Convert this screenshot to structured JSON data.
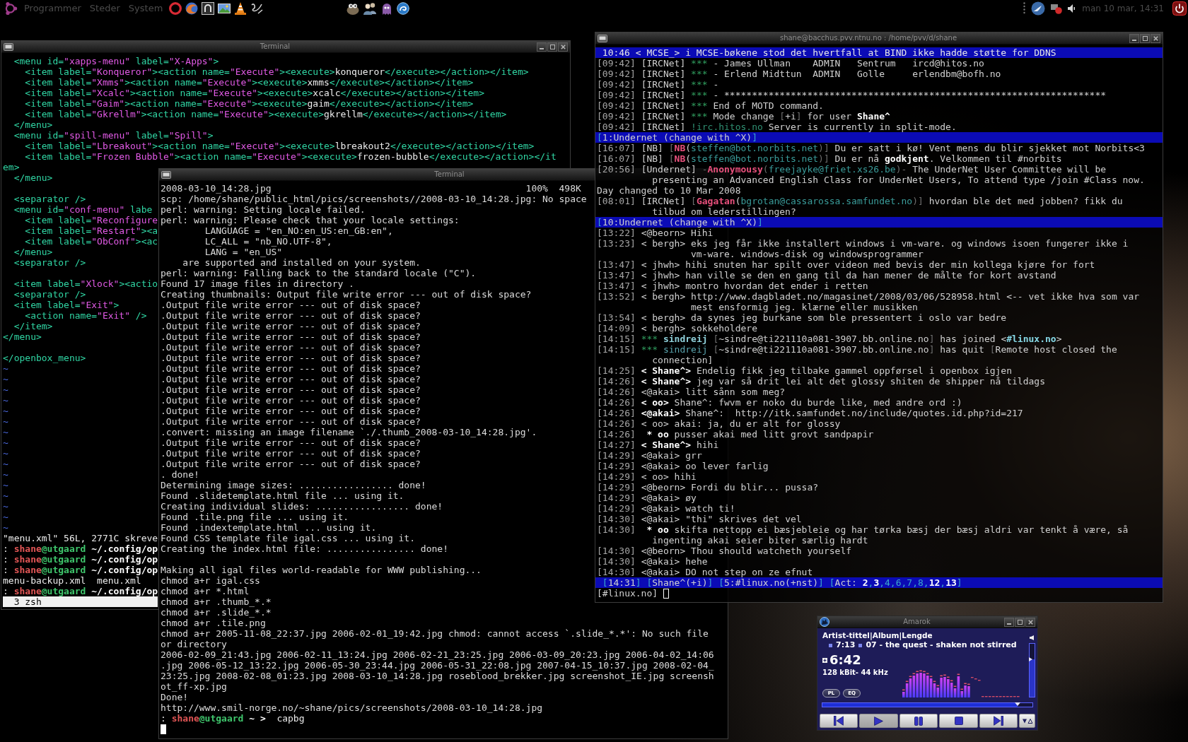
{
  "panel": {
    "menus": [
      "Programmer",
      "Steder",
      "System"
    ],
    "clock": "man 10 mar, 14:31"
  },
  "editor_terminal": {
    "title": "Terminal",
    "lines": [
      {
        "kind": "xml",
        "text": "  <menu id=\"xapps-menu\" label=\"X-Apps\">"
      },
      {
        "kind": "xml",
        "text": "    <item label=\"Konqueror\"><action name=\"Execute\"><execute>konqueror</execute></action></item>"
      },
      {
        "kind": "xml",
        "text": "    <item label=\"Xmms\"><action name=\"Execute\"><execute>xmms</execute></action></item>"
      },
      {
        "kind": "xml",
        "text": "    <item label=\"Xcalc\"><action name=\"Execute\"><execute>xcalc</execute></action></item>"
      },
      {
        "kind": "xml",
        "text": "    <item label=\"Gaim\"><action name=\"Execute\"><execute>gaim</execute></action></item>"
      },
      {
        "kind": "xml",
        "text": "    <item label=\"Gkrellm\"><action name=\"Execute\"><execute>gkrellm</execute></action></item>"
      },
      {
        "kind": "xml",
        "text": "  </menu>"
      },
      {
        "kind": "xml",
        "text": "  <menu id=\"spill-menu\" label=\"Spill\">"
      },
      {
        "kind": "xml",
        "text": "    <item label=\"Lbreakout\"><action name=\"Execute\"><execute>lbreakout2</execute></action></item>"
      },
      {
        "kind": "xml",
        "text": "    <item label=\"Frozen Bubble\"><action name=\"Execute\"><execute>frozen-bubble</execute></action></it"
      },
      {
        "kind": "xml",
        "text": "em>"
      },
      {
        "kind": "xml",
        "text": "  </menu>"
      },
      {
        "kind": "blank"
      },
      {
        "kind": "xml",
        "text": "  <separator />"
      },
      {
        "kind": "xml",
        "text": "  <menu id=\"conf-menu\" labe"
      },
      {
        "kind": "xml",
        "text": "    <item label=\"Reconfigure"
      },
      {
        "kind": "xml",
        "text": "    <item label=\"Restart\"><a"
      },
      {
        "kind": "xml",
        "text": "    <item label=\"ObConf\"><ac"
      },
      {
        "kind": "xml",
        "text": "  </menu>"
      },
      {
        "kind": "xml",
        "text": "  <separator />"
      },
      {
        "kind": "blank"
      },
      {
        "kind": "xml",
        "text": "  <item label=\"Xlock\"><actio"
      },
      {
        "kind": "xml",
        "text": "  <separator />"
      },
      {
        "kind": "xml",
        "text": "  <item label=\"Exit\">"
      },
      {
        "kind": "xml",
        "text": "    <action name=\"Exit\" />"
      },
      {
        "kind": "xml",
        "text": "  </item>"
      },
      {
        "kind": "xml",
        "text": "</menu>"
      },
      {
        "kind": "blank"
      },
      {
        "kind": "xml",
        "text": "</openbox_menu>"
      },
      {
        "kind": "tilde",
        "text": "~"
      },
      {
        "kind": "tilde",
        "text": "~"
      },
      {
        "kind": "tilde",
        "text": "~"
      },
      {
        "kind": "tilde",
        "text": "~"
      },
      {
        "kind": "tilde",
        "text": "~"
      },
      {
        "kind": "tilde",
        "text": "~"
      },
      {
        "kind": "tilde",
        "text": "~"
      },
      {
        "kind": "tilde",
        "text": "~"
      },
      {
        "kind": "tilde",
        "text": "~"
      },
      {
        "kind": "tilde",
        "text": "~"
      },
      {
        "kind": "tilde",
        "text": "~"
      },
      {
        "kind": "tilde",
        "text": "~"
      },
      {
        "kind": "tilde",
        "text": "~"
      },
      {
        "kind": "tilde",
        "text": "~"
      },
      {
        "kind": "tilde",
        "text": "~"
      },
      {
        "kind": "tilde",
        "text": "~"
      },
      {
        "kind": "text",
        "text": "\"menu.xml\" 56L, 2771C skreve"
      },
      {
        "kind": "prompt",
        "prefix": ":",
        "user": "shane",
        "host": "@utgaard",
        "path": "~/.config/op"
      },
      {
        "kind": "prompt",
        "prefix": ":",
        "user": "shane",
        "host": "@utgaard",
        "path": "~/.config/op"
      },
      {
        "kind": "prompt",
        "prefix": ":",
        "user": "shane",
        "host": "@utgaard",
        "path": "~/.config/op"
      },
      {
        "kind": "text",
        "text": "menu-backup.xml  menu.xml"
      },
      {
        "kind": "prompt",
        "prefix": ":",
        "user": "shane",
        "host": "@utgaard",
        "path": "~/.config/op"
      },
      {
        "kind": "tabs",
        "text": "3 zsh"
      }
    ]
  },
  "output_terminal": {
    "title": "Terminal",
    "lines": [
      {
        "kind": "progress",
        "file": "2008-03-10_14:28.jpg",
        "stats": "100%  498K"
      },
      {
        "kind": "text",
        "text": "scp: /home/shane/public_html/pics/screenshots//2008-03-10_14:28.jpg: No space"
      },
      {
        "kind": "text",
        "text": "perl: warning: Setting locale failed."
      },
      {
        "kind": "text",
        "text": "perl: warning: Please check that your locale settings:"
      },
      {
        "kind": "text",
        "text": "        LANGUAGE = \"en_NO:en_US:en_GB:en\","
      },
      {
        "kind": "text",
        "text": "        LC_ALL = \"nb_NO.UTF-8\","
      },
      {
        "kind": "text",
        "text": "        LANG = \"en_US\""
      },
      {
        "kind": "text",
        "text": "    are supported and installed on your system."
      },
      {
        "kind": "text",
        "text": "perl: warning: Falling back to the standard locale (\"C\")."
      },
      {
        "kind": "text",
        "text": "Found 17 image files in directory ."
      },
      {
        "kind": "text",
        "text": "Creating thumbnails: Output file write error --- out of disk space?"
      },
      {
        "kind": "text",
        "text": ".Output file write error --- out of disk space?"
      },
      {
        "kind": "text",
        "text": ".Output file write error --- out of disk space?"
      },
      {
        "kind": "text",
        "text": ".Output file write error --- out of disk space?"
      },
      {
        "kind": "text",
        "text": ".Output file write error --- out of disk space?"
      },
      {
        "kind": "text",
        "text": ".Output file write error --- out of disk space?"
      },
      {
        "kind": "text",
        "text": ".Output file write error --- out of disk space?"
      },
      {
        "kind": "text",
        "text": ".Output file write error --- out of disk space?"
      },
      {
        "kind": "text",
        "text": ".Output file write error --- out of disk space?"
      },
      {
        "kind": "text",
        "text": ".Output file write error --- out of disk space?"
      },
      {
        "kind": "text",
        "text": ".Output file write error --- out of disk space?"
      },
      {
        "kind": "text",
        "text": ".Output file write error --- out of disk space?"
      },
      {
        "kind": "text",
        "text": ".Output file write error --- out of disk space?"
      },
      {
        "kind": "text",
        "text": ".convert: missing an image filename `./.thumb_2008-03-10_14:28.jpg'."
      },
      {
        "kind": "text",
        "text": ".Output file write error --- out of disk space?"
      },
      {
        "kind": "text",
        "text": ".Output file write error --- out of disk space?"
      },
      {
        "kind": "text",
        "text": ".Output file write error --- out of disk space?"
      },
      {
        "kind": "text",
        "text": ". done!"
      },
      {
        "kind": "text",
        "text": "Determining image sizes: ................. done!"
      },
      {
        "kind": "text",
        "text": "Found .slidetemplate.html file ... using it."
      },
      {
        "kind": "text",
        "text": "Creating individual slides: ................. done!"
      },
      {
        "kind": "text",
        "text": "Found .tile.png file ... using it."
      },
      {
        "kind": "text",
        "text": "Found .indextemplate.html ... using it."
      },
      {
        "kind": "text",
        "text": "Found CSS template file igal.css ... using it."
      },
      {
        "kind": "text",
        "text": "Creating the index.html file: ................ done!"
      },
      {
        "kind": "blank"
      },
      {
        "kind": "text",
        "text": "Making all igal files world-readable for WWW publishing..."
      },
      {
        "kind": "text",
        "text": "chmod a+r igal.css"
      },
      {
        "kind": "text",
        "text": "chmod a+r *.html"
      },
      {
        "kind": "text",
        "text": "chmod a+r .thumb_*.*"
      },
      {
        "kind": "text",
        "text": "chmod a+r .slide_*.*"
      },
      {
        "kind": "text",
        "text": "chmod a+r .tile.png"
      },
      {
        "kind": "text",
        "text": "chmod a+r 2005-11-08_22:37.jpg 2006-02-01_19:42.jpg chmod: cannot access `.slide_*.*': No such file"
      },
      {
        "kind": "text",
        "text": "or directory"
      },
      {
        "kind": "text",
        "text": "2006-02-09_21:43.jpg 2006-02-11_13:24.jpg 2006-02-21_23:25.jpg 2006-03-09_20:23.jpg 2006-04-02_14:06"
      },
      {
        "kind": "text",
        "text": ".jpg 2006-05-12_13:22.jpg 2006-05-30_23:44.jpg 2006-05-31_22:08.jpg 2007-04-15_10:37.jpg 2008-02-04_"
      },
      {
        "kind": "text",
        "text": "23:25.jpg 2008-02-08_01:23.jpg 2008-03-10_14:28.jpg roseblood_brekker.jpg screenshot_IE.jpg screensh"
      },
      {
        "kind": "text",
        "text": "ot_ff-xp.jpg"
      },
      {
        "kind": "text",
        "text": "Done!"
      },
      {
        "kind": "text",
        "text": "http://www.smil-norge.no/~shane/pics/screenshots/2008-03-10_14:28.jpg"
      },
      {
        "kind": "prompt",
        "prefix": ":",
        "user": "shane",
        "host": "@utgaard",
        "path": "~ >",
        "command": "capbg"
      },
      {
        "kind": "cursor"
      }
    ]
  },
  "irc_terminal": {
    "title": "shane@bacchus.pvv.ntnu.no : /home/pvv/d/shane",
    "lines": [
      {
        "kind": "topic",
        "text": "10:46 < MCSE_> i MCSE-bøkene stod det hvertfall at BIND ikke hadde støtte for DDNS"
      },
      {
        "kind": "event",
        "time": "[09:42]",
        "segments": [
          {
            "text": "[IRCNet] ",
            "kind": "plain"
          },
          {
            "text": "***",
            "kind": "marker"
          },
          {
            "text": " - James Ullman    ADMIN   Sentrum   ircd@hitos.no",
            "kind": "plain"
          }
        ]
      },
      {
        "kind": "event",
        "time": "[09:42]",
        "segments": [
          {
            "text": "[IRCNet] ",
            "kind": "plain"
          },
          {
            "text": "***",
            "kind": "marker"
          },
          {
            "text": " - Erlend Midttun  ADMIN   Golle     erlendbm@bofh.no",
            "kind": "plain"
          }
        ]
      },
      {
        "kind": "event",
        "time": "[09:42]",
        "segments": [
          {
            "text": "[IRCNet] ",
            "kind": "plain"
          },
          {
            "text": "***",
            "kind": "marker"
          },
          {
            "text": " -",
            "kind": "plain"
          }
        ]
      },
      {
        "kind": "event",
        "time": "[09:42]",
        "segments": [
          {
            "text": "[IRCNet] ",
            "kind": "plain"
          },
          {
            "text": "***",
            "kind": "marker"
          },
          {
            "text": " - *********************************************************************",
            "kind": "plain"
          }
        ]
      },
      {
        "kind": "event",
        "time": "[09:42]",
        "segments": [
          {
            "text": "[IRCNet] ",
            "kind": "plain"
          },
          {
            "text": "***",
            "kind": "marker"
          },
          {
            "text": " End of MOTD command.",
            "kind": "plain"
          }
        ]
      },
      {
        "kind": "event",
        "time": "[09:42]",
        "segments": [
          {
            "text": "[IRCNet] ",
            "kind": "plain"
          },
          {
            "text": "***",
            "kind": "marker"
          },
          {
            "text": " Mode change ",
            "kind": "plain"
          },
          {
            "text": "[",
            "kind": "dim"
          },
          {
            "text": "+i",
            "kind": "plain"
          },
          {
            "text": "]",
            "kind": "dim"
          },
          {
            "text": " for user ",
            "kind": "plain"
          },
          {
            "text": "Shane^",
            "kind": "bold"
          }
        ]
      },
      {
        "kind": "event",
        "time": "[09:42]",
        "segments": [
          {
            "text": "[IRCNet] ",
            "kind": "plain"
          },
          {
            "text": "!irc.hitos.no",
            "kind": "server"
          },
          {
            "text": " Server is currently in split-mode.",
            "kind": "plain"
          }
        ]
      },
      {
        "kind": "bar",
        "segments": [
          {
            "text": "[",
            "kind": "bracket"
          },
          {
            "text": "1:Undernet (change with ^X)",
            "kind": "plain"
          },
          {
            "text": "]",
            "kind": "bracket"
          }
        ]
      },
      {
        "kind": "event",
        "time": "[16:07]",
        "segments": [
          {
            "text": "[NB] ",
            "kind": "plain"
          },
          {
            "text": "[",
            "kind": "dim"
          },
          {
            "text": "NB",
            "kind": "nick"
          },
          {
            "text": "(",
            "kind": "plain"
          },
          {
            "text": "steffen@bot.norbits.net",
            "kind": "host"
          },
          {
            "text": ")]",
            "kind": "dim"
          },
          {
            "text": " Du er satt i kø! Vent mens du blir sjekket mot Norbits<3",
            "kind": "plain"
          }
        ]
      },
      {
        "kind": "event",
        "time": "[16:07]",
        "segments": [
          {
            "text": "[NB] ",
            "kind": "plain"
          },
          {
            "text": "[",
            "kind": "dim"
          },
          {
            "text": "NB",
            "kind": "nick"
          },
          {
            "text": "(",
            "kind": "plain"
          },
          {
            "text": "steffen@bot.norbits.net",
            "kind": "host"
          },
          {
            "text": ")]",
            "kind": "dim"
          },
          {
            "text": " Du er nå ",
            "kind": "plain"
          },
          {
            "text": "godkjent",
            "kind": "bold"
          },
          {
            "text": ". Velkommen til #norbits",
            "kind": "plain"
          }
        ]
      },
      {
        "kind": "event",
        "time": "[20:56]",
        "segments": [
          {
            "text": "[Undernet] ",
            "kind": "plain"
          },
          {
            "text": "-",
            "kind": "dim"
          },
          {
            "text": "Anonymousy",
            "kind": "nick"
          },
          {
            "text": "(",
            "kind": "dim"
          },
          {
            "text": "freejayke@friet.xs26.be",
            "kind": "host"
          },
          {
            "text": ")-",
            "kind": "dim"
          },
          {
            "text": " The UnderNet User Committee will be",
            "kind": "plain"
          }
        ],
        "wrap": "presenting an Advanced English Class for UnderNet Users, To attend type /join #Class now."
      },
      {
        "kind": "plain",
        "text": "Day changed to 10 Mar 2008"
      },
      {
        "kind": "event",
        "time": "[08:01]",
        "segments": [
          {
            "text": "[IRCNet] ",
            "kind": "plain"
          },
          {
            "text": "[",
            "kind": "dim"
          },
          {
            "text": "Gagatan",
            "kind": "nick"
          },
          {
            "text": "(",
            "kind": "plain"
          },
          {
            "text": "bgrotan@cassarossa.samfundet.no",
            "kind": "host"
          },
          {
            "text": ")]",
            "kind": "dim"
          },
          {
            "text": " hvordan ble det med jobben? fikk du",
            "kind": "plain"
          }
        ],
        "wrap": "tilbud om lederstillingen?"
      },
      {
        "kind": "bar",
        "segments": [
          {
            "text": "[",
            "kind": "bracket"
          },
          {
            "text": "10:Undernet (change with ^X)",
            "kind": "plain"
          },
          {
            "text": "]",
            "kind": "bracket"
          }
        ]
      },
      {
        "kind": "message",
        "time": "[13:22]",
        "nick": "<@beorn>",
        "highlight": false,
        "text": "Hihi"
      },
      {
        "kind": "message",
        "time": "[13:23]",
        "nick": "< bergh>",
        "highlight": false,
        "text": "eks jeg får ikke installert windows i vm-ware. og windows isoen fungerer ikke i",
        "wrap": "vm-ware. windows-disk og windowsprogrammer"
      },
      {
        "kind": "message",
        "time": "[13:47]",
        "nick": "< jhwh>",
        "highlight": false,
        "text": "hihi snuten har spilt over videon med bevis der min kollega kjøre for fort"
      },
      {
        "kind": "message",
        "time": "[13:47]",
        "nick": "< jhwh>",
        "highlight": false,
        "text": "han ville se den en gang til da han mener de målte for kort avstand"
      },
      {
        "kind": "message",
        "time": "[13:47]",
        "nick": "< jhwh>",
        "highlight": false,
        "text": "montro hvordan det ender i retten"
      },
      {
        "kind": "message",
        "time": "[13:52]",
        "nick": "< bergh>",
        "highlight": false,
        "text": "http://www.dagbladet.no/magasinet/2008/03/06/528958.html <-- vet ikke hva som var",
        "wrap": "mest ensformig jeg. klærne eller musikken"
      },
      {
        "kind": "message",
        "time": "[13:54]",
        "nick": "< bergh>",
        "highlight": false,
        "text": "da synes jeg burkane som ble pressentert i oslo var bedre"
      },
      {
        "kind": "message",
        "time": "[14:09]",
        "nick": "< bergh>",
        "highlight": false,
        "text": "sokkeholdere"
      },
      {
        "kind": "event",
        "time": "[14:15]",
        "segments": [
          {
            "text": "*** ",
            "kind": "marker"
          },
          {
            "text": "sindreij",
            "kind": "join"
          },
          {
            "text": " [",
            "kind": "dim"
          },
          {
            "text": "~sindre@ti221110a081-3907.bb.online.no",
            "kind": "plain"
          },
          {
            "text": "]",
            "kind": "dim"
          },
          {
            "text": " has joined <",
            "kind": "plain"
          },
          {
            "text": "#linux.no",
            "kind": "channel"
          },
          {
            "text": ">",
            "kind": "plain"
          }
        ]
      },
      {
        "kind": "event",
        "time": "[14:15]",
        "segments": [
          {
            "text": "*** ",
            "kind": "marker"
          },
          {
            "text": "sindreij",
            "kind": "quit"
          },
          {
            "text": " [",
            "kind": "dim"
          },
          {
            "text": "~sindre@ti221110a081-3907.bb.online.no",
            "kind": "plain"
          },
          {
            "text": "]",
            "kind": "dim"
          },
          {
            "text": " has quit ",
            "kind": "plain"
          },
          {
            "text": "[",
            "kind": "dim"
          },
          {
            "text": "Remote host closed the",
            "kind": "plain"
          }
        ],
        "wrap": "connection]"
      },
      {
        "kind": "message",
        "time": "[14:25]",
        "nick": "< Shane^>",
        "highlight": true,
        "text": "Endelig fikk jeg tilbake gammel oppførsel i openbox igjen"
      },
      {
        "kind": "message",
        "time": "[14:26]",
        "nick": "< Shane^>",
        "highlight": true,
        "text": "jeg var så drit lei alt det glossy shiten de shipper nå tildags"
      },
      {
        "kind": "message",
        "time": "[14:26]",
        "nick": "<@akai>",
        "highlight": false,
        "text": "litt sånn som meg?"
      },
      {
        "kind": "message",
        "time": "[14:26]",
        "nick": "< oo>",
        "highlight": true,
        "text": "Shane^: fwvm er noko du burde like, med andre ord :)"
      },
      {
        "kind": "message",
        "time": "[14:26]",
        "nick": "<@akai>",
        "highlight": true,
        "text": "Shane^:  http://itk.samfundet.no/include/quotes.id.php?id=217"
      },
      {
        "kind": "message",
        "time": "[14:26]",
        "nick": "< oo>",
        "highlight": false,
        "text": "akai: ja, du er alt for glossy"
      },
      {
        "kind": "action",
        "time": "[14:26]",
        "nick": "* oo",
        "text": "pusser akai med litt grovt sandpapir"
      },
      {
        "kind": "message",
        "time": "[14:27]",
        "nick": "< Shane^>",
        "highlight": true,
        "text": "hihi"
      },
      {
        "kind": "message",
        "time": "[14:29]",
        "nick": "<@akai>",
        "highlight": false,
        "text": "grr"
      },
      {
        "kind": "message",
        "time": "[14:29]",
        "nick": "<@akai>",
        "highlight": false,
        "text": "oo lever farlig"
      },
      {
        "kind": "message",
        "time": "[14:29]",
        "nick": "< oo>",
        "highlight": false,
        "text": "hihi"
      },
      {
        "kind": "message",
        "time": "[14:29]",
        "nick": "<@beorn>",
        "highlight": false,
        "text": "Fordi du blir... pussa?"
      },
      {
        "kind": "message",
        "time": "[14:29]",
        "nick": "<@akai>",
        "highlight": false,
        "text": "øy"
      },
      {
        "kind": "message",
        "time": "[14:29]",
        "nick": "<@akai>",
        "highlight": false,
        "text": "watch ti!"
      },
      {
        "kind": "message",
        "time": "[14:30]",
        "nick": "<@akai>",
        "highlight": false,
        "text": "\"thi\" skrives det vel"
      },
      {
        "kind": "action",
        "time": "[14:30]",
        "nick": "* oo",
        "text": "skifta nettopp ei bæsjebleie og har tørka bæsj der bæsj aldri var tenkt å være, så",
        "wrap": "ingenting akai seier biter særlig hardt"
      },
      {
        "kind": "message",
        "time": "[14:30]",
        "nick": "<@beorn>",
        "highlight": false,
        "text": "Thou should watcheth yourself"
      },
      {
        "kind": "message",
        "time": "[14:30]",
        "nick": "<@akai>",
        "highlight": false,
        "text": "hehe"
      },
      {
        "kind": "message",
        "time": "[14:30]",
        "nick": "<@akai>",
        "highlight": false,
        "text": "DO not step on ze efnut"
      },
      {
        "kind": "status",
        "segments": [
          {
            "text": "[",
            "kind": "bracket"
          },
          {
            "text": "14:31",
            "kind": "plain"
          },
          {
            "text": "] [",
            "kind": "bracket"
          },
          {
            "text": "Shane^(+i)",
            "kind": "plain"
          },
          {
            "text": "] [",
            "kind": "bracket"
          },
          {
            "text": "5:#linux.no(+nst)",
            "kind": "plain"
          },
          {
            "text": "] [",
            "kind": "bracket"
          },
          {
            "text": "Act: ",
            "kind": "plain"
          },
          {
            "text": "2",
            "kind": "bold"
          },
          {
            "text": ",",
            "kind": "bracket"
          },
          {
            "text": "3",
            "kind": "bold"
          },
          {
            "text": ",4,6,7,8,",
            "kind": "bracket"
          },
          {
            "text": "12",
            "kind": "bold"
          },
          {
            "text": ",",
            "kind": "bracket"
          },
          {
            "text": "13",
            "kind": "bold"
          },
          {
            "text": "]",
            "kind": "bracket"
          }
        ]
      },
      {
        "kind": "input",
        "text": "[#linux.no]",
        "cursor": true
      }
    ]
  },
  "amarok": {
    "title": "Amarok",
    "header": "Artist-tittel|Album|Lengde",
    "track_info": [
      "7:13",
      "07 - the quest - shaken not stirred"
    ],
    "time": "6:42",
    "bitrate": "128 kBit- 44 kHz",
    "toggles": [
      "PL",
      "EQ"
    ],
    "volume": {
      "level": 0.71
    },
    "position": {
      "level": 0.93
    },
    "controls": [
      {
        "kind": "previous",
        "selected": false
      },
      {
        "kind": "play",
        "selected": true
      },
      {
        "kind": "pause",
        "selected": false
      },
      {
        "kind": "stop",
        "selected": false
      },
      {
        "kind": "next",
        "selected": false
      },
      {
        "kind": "analyzer",
        "selected": false
      }
    ]
  }
}
